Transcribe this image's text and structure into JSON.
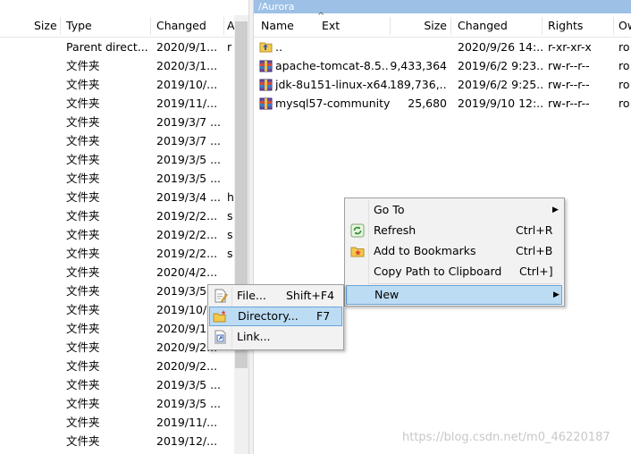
{
  "left_pane": {
    "columns": {
      "size": "Size",
      "type": "Type",
      "changed": "Changed",
      "attr": "A"
    },
    "rows": [
      {
        "type": "Parent direct...",
        "changed": "2020/9/1...",
        "attr": "r"
      },
      {
        "type": "文件夹",
        "changed": "2020/3/1...",
        "attr": ""
      },
      {
        "type": "文件夹",
        "changed": "2019/10/...",
        "attr": ""
      },
      {
        "type": "文件夹",
        "changed": "2019/11/...",
        "attr": ""
      },
      {
        "type": "文件夹",
        "changed": "2019/3/7 ...",
        "attr": ""
      },
      {
        "type": "文件夹",
        "changed": "2019/3/7 ...",
        "attr": ""
      },
      {
        "type": "文件夹",
        "changed": "2019/3/5 ...",
        "attr": ""
      },
      {
        "type": "文件夹",
        "changed": "2019/3/5 ...",
        "attr": ""
      },
      {
        "type": "文件夹",
        "changed": "2019/3/4 ...",
        "attr": "h"
      },
      {
        "type": "文件夹",
        "changed": "2019/2/2...",
        "attr": "s"
      },
      {
        "type": "文件夹",
        "changed": "2019/2/2...",
        "attr": "s"
      },
      {
        "type": "文件夹",
        "changed": "2019/2/2...",
        "attr": "s"
      },
      {
        "type": "文件夹",
        "changed": "2020/4/2...",
        "attr": ""
      },
      {
        "type": "文件夹",
        "changed": "2019/3/5",
        "attr": ""
      },
      {
        "type": "文件夹",
        "changed": "2019/10/...",
        "attr": ""
      },
      {
        "type": "文件夹",
        "changed": "2020/9/1...",
        "attr": ""
      },
      {
        "type": "文件夹",
        "changed": "2020/9/2...",
        "attr": ""
      },
      {
        "type": "文件夹",
        "changed": "2020/9/2...",
        "attr": ""
      },
      {
        "type": "文件夹",
        "changed": "2019/3/5 ...",
        "attr": ""
      },
      {
        "type": "文件夹",
        "changed": "2019/3/5 ...",
        "attr": ""
      },
      {
        "type": "文件夹",
        "changed": "2019/11/...",
        "attr": ""
      },
      {
        "type": "文件夹",
        "changed": "2019/12/...",
        "attr": ""
      }
    ]
  },
  "right_pane": {
    "path": "/Aurora",
    "columns": {
      "name": "Name",
      "ext": "Ext",
      "size": "Size",
      "changed": "Changed",
      "rights": "Rights",
      "owner": "Ow"
    },
    "rows": [
      {
        "icon": "parent-dir-icon",
        "name": "..",
        "size": "",
        "changed": "2020/9/26 14:...",
        "rights": "r-xr-xr-x",
        "owner": "ro"
      },
      {
        "icon": "archive-icon",
        "name": "apache-tomcat-8.5....",
        "size": "9,433,364",
        "changed": "2019/6/2 9:23...",
        "rights": "rw-r--r--",
        "owner": "ro"
      },
      {
        "icon": "archive-icon",
        "name": "jdk-8u151-linux-x64....",
        "size": "189,736,...",
        "changed": "2019/6/2 9:25...",
        "rights": "rw-r--r--",
        "owner": "ro"
      },
      {
        "icon": "archive-icon",
        "name": "mysql57-community....",
        "size": "25,680",
        "changed": "2019/9/10 12:...",
        "rights": "rw-r--r--",
        "owner": "ro"
      }
    ]
  },
  "context_menu": {
    "items": [
      {
        "label": "Go To",
        "shortcut": "",
        "submenu": true
      },
      {
        "label": "Refresh",
        "shortcut": "Ctrl+R",
        "icon": "refresh-icon"
      },
      {
        "label": "Add to Bookmarks",
        "shortcut": "Ctrl+B",
        "icon": "bookmark-icon"
      },
      {
        "label": "Copy Path to Clipboard",
        "shortcut": "Ctrl+]"
      },
      {
        "label": "New",
        "shortcut": "",
        "submenu": true,
        "highlighted": true
      }
    ]
  },
  "new_submenu": {
    "items": [
      {
        "label": "File...",
        "shortcut": "Shift+F4",
        "icon": "new-file-icon"
      },
      {
        "label": "Directory...",
        "shortcut": "F7",
        "icon": "new-directory-icon",
        "highlighted": true
      },
      {
        "label": "Link...",
        "shortcut": "",
        "icon": "new-link-icon"
      }
    ]
  },
  "watermark": "https://blog.csdn.net/m0_46220187",
  "colors": {
    "highlight_bg": "#bcdcf4",
    "highlight_border": "#6aa4d8",
    "path_bar": "#9cc0e6",
    "menu_bg": "#f2f2f2"
  }
}
